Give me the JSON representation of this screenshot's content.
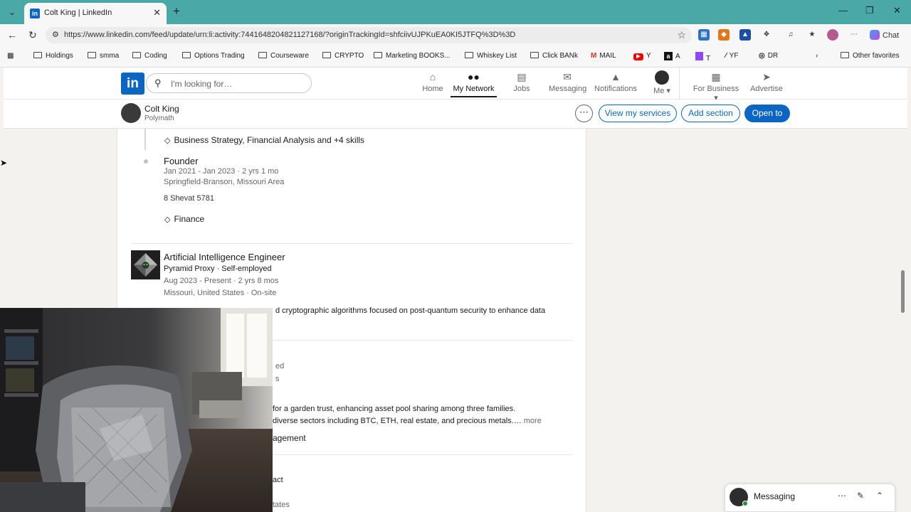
{
  "browser": {
    "tab_title": "Colt King | LinkedIn",
    "url": "https://www.linkedin.com/feed/update/urn:li:activity:7441648204821127168/?originTrackingId=shfciivUJPKuEA0KI5JTFQ%3D%3D",
    "chat_label": "Chat",
    "bookmarks": [
      "Holdings",
      "smma",
      "Coding",
      "Options Trading",
      "Courseware",
      "CRYPTO",
      "Marketing BOOKS...",
      "Whiskey List",
      "Click BANk",
      "MAIL",
      "Y",
      "A",
      "T",
      "YF",
      "DR",
      "Other favorites"
    ]
  },
  "linkedin": {
    "search_placeholder": "I'm looking for…",
    "nav": [
      {
        "label": "Home",
        "icon": "home-icon"
      },
      {
        "label": "My Network",
        "icon": "network-icon"
      },
      {
        "label": "Jobs",
        "icon": "briefcase-icon"
      },
      {
        "label": "Messaging",
        "icon": "message-icon"
      },
      {
        "label": "Notifications",
        "icon": "bell-icon"
      },
      {
        "label": "Me",
        "icon": "avatar"
      },
      {
        "label": "For Business",
        "icon": "grid-icon"
      },
      {
        "label": "Advertise",
        "icon": "advertise-icon"
      }
    ]
  },
  "profile": {
    "name": "Colt King",
    "headline": "Polymath",
    "buttons": {
      "view_services": "View my services",
      "add_section": "Add section",
      "open_to": "Open to"
    }
  },
  "experience": {
    "skills_line_1": "Business Strategy, Financial Analysis and +4 skills",
    "founder": {
      "title": "Founder",
      "dates": "Jan 2021 - Jan 2023 · 2 yrs 1 mo",
      "location": "Springfield-Branson, Missouri Area",
      "note": "8 Shevat 5781",
      "skill": "Finance"
    },
    "ai_engineer": {
      "title": "Artificial Intelligence Engineer",
      "company": "Pyramid Proxy · Self-employed",
      "dates": "Aug 2023 - Present · 2 yrs 8 mos",
      "location": "Missouri, United States · On-site",
      "description": "d cryptographic algorithms focused on post-quantum security to enhance data"
    },
    "fragment_1": "ed",
    "fragment_2": "s",
    "desc_line_1": "for a garden trust, enhancing asset pool sharing among three families.",
    "desc_line_2": " diverse sectors including BTC, ETH, real estate, and precious metals.…",
    "more": "more",
    "skill_fragment": "agement",
    "fragment_3": "act",
    "fragment_4": "tates"
  },
  "messaging": {
    "label": "Messaging"
  },
  "colors": {
    "linkedin_blue": "#0a66c2",
    "tabbar": "#4aa9a6",
    "page_bg": "#f4f2ee"
  }
}
